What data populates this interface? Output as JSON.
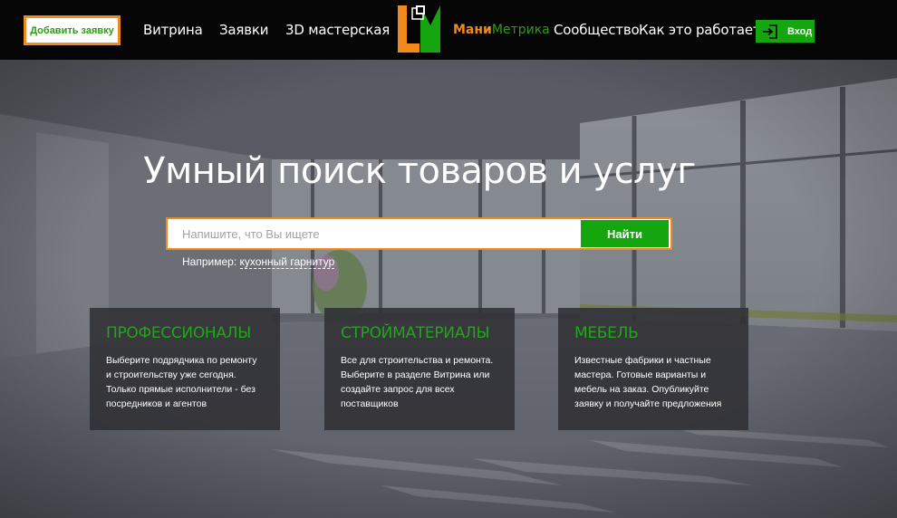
{
  "header": {
    "add_request_label": "Добавить заявку",
    "nav": [
      {
        "label": "Витрина"
      },
      {
        "label": "Заявки"
      },
      {
        "label": "3D мастерская"
      }
    ],
    "brand": {
      "part1": "Мани",
      "part2": "Метрика"
    },
    "community_label": "Сообщество",
    "how_label": "Как это работает?",
    "login_label": "Вход"
  },
  "hero": {
    "title": "Умный поиск товаров и услуг",
    "search": {
      "placeholder": "Напишите, что Вы ищете",
      "value": "",
      "button_label": "Найти"
    },
    "example": {
      "prefix": "Например:",
      "link": "кухонный гарнитур"
    }
  },
  "cards": [
    {
      "title": "ПРОФЕССИОНАЛЫ",
      "text": "Выберите подрядчика по ремонту и строительству уже сегодня. Только прямые исполнители - без посредников и агентов"
    },
    {
      "title": "СТРОЙМАТЕРИАЛЫ",
      "text": "Все для строительства и ремонта. Выберите в разделе Витрина или создайте запрос для всех поставщиков"
    },
    {
      "title": "МЕБЕЛЬ",
      "text": "Известные фабрики и частные мастера. Готовые варианты и мебель на заказ. Опубликуйте заявку и получайте предложения"
    }
  ],
  "colors": {
    "accent_green": "#15a50f",
    "accent_orange": "#f08a1c",
    "header_bg": "#050505"
  },
  "icons": {
    "logo": "lm-logo-icon",
    "login": "login-arrow-icon"
  }
}
